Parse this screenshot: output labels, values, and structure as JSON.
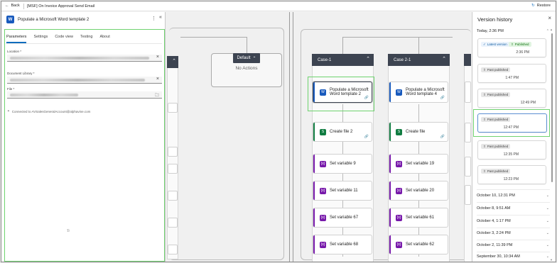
{
  "topbar": {
    "back_label": "Back",
    "flow_title": "[MSF] On Invoice Approval Send Email",
    "restore_label": "Restore"
  },
  "panel": {
    "title": "Populate a Microsoft Word template 2",
    "tabs": [
      "Parameters",
      "Settings",
      "Code view",
      "Testing",
      "About"
    ],
    "location_label": "Location *",
    "library_label": "Document Library *",
    "file_label": "File *",
    "connected_text": "Connected to AVSalesGeneralAccount@alphavine.com"
  },
  "canvas": {
    "default_label": "Default",
    "no_actions": "No Actions",
    "case1": {
      "label": "Case-1",
      "nodes": [
        "Populate a Microsoft Word template 2",
        "Create file 2",
        "Set variable 9",
        "Set variable 11",
        "Set variable 67",
        "Set variable 68"
      ]
    },
    "case21": {
      "label": "Case 2-1",
      "nodes": [
        "Populate a Microsoft Word template 4",
        "Create file",
        "Set variable 19",
        "Set variable 20",
        "Set variable 61",
        "Set variable 62"
      ]
    }
  },
  "version_history": {
    "title": "Version history",
    "today_label": "Today, 2:36 PM",
    "latest_badge": "Latest version",
    "published_badge": "Published",
    "past_badge": "Past published",
    "cards": [
      {
        "time": "2:36 PM"
      },
      {
        "time": "1:47 PM"
      },
      {
        "time": "12:49 PM"
      },
      {
        "time": "12:47 PM"
      },
      {
        "time": "12:35 PM"
      },
      {
        "time": "12:23 PM"
      }
    ],
    "groups": [
      "October 10, 12:31 PM",
      "October 8, 9:51 AM",
      "October 4, 1:17 PM",
      "October 3, 2:24 PM",
      "October 2, 11:39 PM",
      "September 30, 10:34 AM"
    ]
  },
  "colors": {
    "header_dark": "#3d4451",
    "word_blue": "#185abd",
    "excel_green": "#107c41",
    "variable_purple": "#7719aa",
    "highlight_green": "#6fd36f",
    "selection_blue": "#5b8fd1"
  }
}
